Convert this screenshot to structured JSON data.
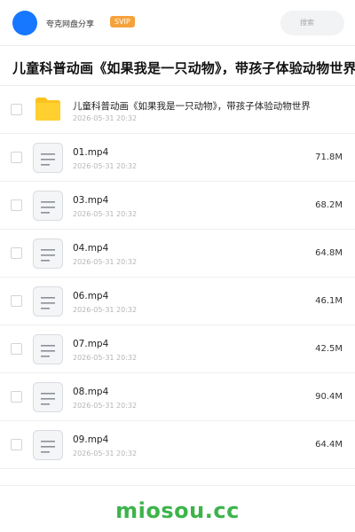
{
  "header": {
    "app_name": "夸克网盘分享",
    "badge": "SVIP",
    "search_placeholder": "搜索",
    "avatar_color": "#1677ff",
    "badge_color": "#f6a23a"
  },
  "page_title": "儿童科普动画《如果我是一只动物》，带孩子体验动物世界",
  "files": [
    {
      "type": "folder",
      "icon": "folder-icon",
      "name": "儿童科普动画《如果我是一只动物》，带孩子体验动物世界",
      "date": "2026-05-31 20:32",
      "size": ""
    },
    {
      "type": "file",
      "icon": "document-icon",
      "name": "01.mp4",
      "date": "2026-05-31 20:32",
      "size": "71.8M"
    },
    {
      "type": "file",
      "icon": "document-icon",
      "name": "03.mp4",
      "date": "2026-05-31 20:32",
      "size": "68.2M"
    },
    {
      "type": "file",
      "icon": "document-icon",
      "name": "04.mp4",
      "date": "2026-05-31 20:32",
      "size": "64.8M"
    },
    {
      "type": "file",
      "icon": "document-icon",
      "name": "06.mp4",
      "date": "2026-05-31 20:32",
      "size": "46.1M"
    },
    {
      "type": "file",
      "icon": "document-icon",
      "name": "07.mp4",
      "date": "2026-05-31 20:32",
      "size": "42.5M"
    },
    {
      "type": "file",
      "icon": "document-icon",
      "name": "08.mp4",
      "date": "2026-05-31 20:32",
      "size": "90.4M"
    },
    {
      "type": "file",
      "icon": "document-icon",
      "name": "09.mp4",
      "date": "2026-05-31 20:32",
      "size": "64.4M"
    }
  ],
  "watermark": "miosou.cc",
  "watermark_color": "#3cb44b"
}
